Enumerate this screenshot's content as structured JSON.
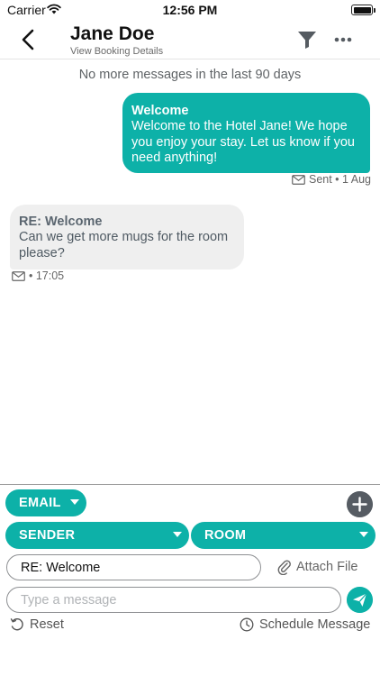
{
  "status_bar": {
    "carrier": "Carrier",
    "time": "12:56 PM"
  },
  "header": {
    "title": "Jane Doe",
    "subtitle": "View Booking Details",
    "back_icon": "chevron-left-icon",
    "filter_icon": "filter-funnel-icon",
    "more_icon": "ellipsis-icon"
  },
  "thread": {
    "notice": "No more messages in the last 90 days",
    "messages": [
      {
        "direction": "outgoing",
        "title": "Welcome",
        "body": "Welcome to the Hotel Jane! We hope you enjoy your stay. Let us know if you need anything!",
        "meta": "Sent • 1 Aug",
        "channel_icon": "mail-icon"
      },
      {
        "direction": "incoming",
        "title": "RE: Welcome",
        "body": "Can we get more mugs for the room please?",
        "meta": "• 17:05",
        "channel_icon": "mail-icon"
      }
    ]
  },
  "composer": {
    "channel": "EMAIL",
    "sender": "SENDER",
    "room": "ROOM",
    "subject": "RE: Welcome",
    "message_placeholder": "Type a message",
    "attach_label": "Attach File",
    "reset_label": "Reset",
    "schedule_label": "Schedule Message"
  },
  "colors": {
    "accent": "#0db1a8",
    "incoming_bubble": "#efefef",
    "plus_button": "#565c63"
  }
}
